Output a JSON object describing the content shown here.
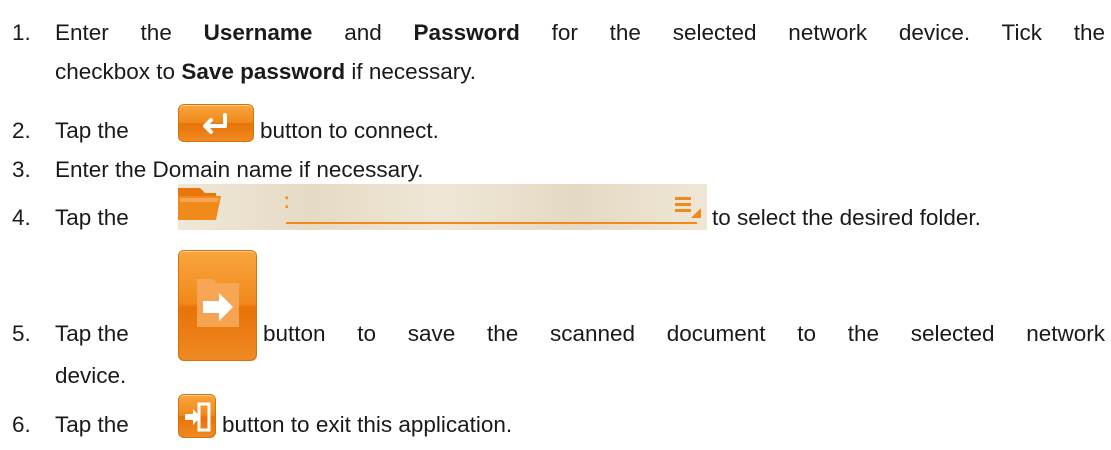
{
  "steps": [
    {
      "number": "1.",
      "line1": {
        "t1": "Enter the ",
        "b1": "Username",
        "t2": " and ",
        "b2": "Password",
        "t3": " for the selected network device. Tick the"
      },
      "line2": {
        "t1": "checkbox to ",
        "b1": "Save password",
        "t2": " if necessary."
      }
    },
    {
      "number": "2.",
      "before": "Tap the",
      "icon": "enter-arrow-icon",
      "after": "button to connect."
    },
    {
      "number": "3.",
      "text": "Enter the Domain name if necessary."
    },
    {
      "number": "4.",
      "before": "Tap the",
      "icon": "folder-path-bar",
      "after": "to select the desired folder."
    },
    {
      "number": "5.",
      "before": "Tap the",
      "icon": "save-to-folder-icon",
      "after": "button to save the scanned document to the selected network",
      "line2": "device."
    },
    {
      "number": "6.",
      "before": "Tap the",
      "icon": "exit-door-icon",
      "after": "button to exit this application."
    }
  ],
  "colors": {
    "accent": "#f08a1a",
    "bar": "#ece2cf",
    "text": "#1a1a1a"
  }
}
